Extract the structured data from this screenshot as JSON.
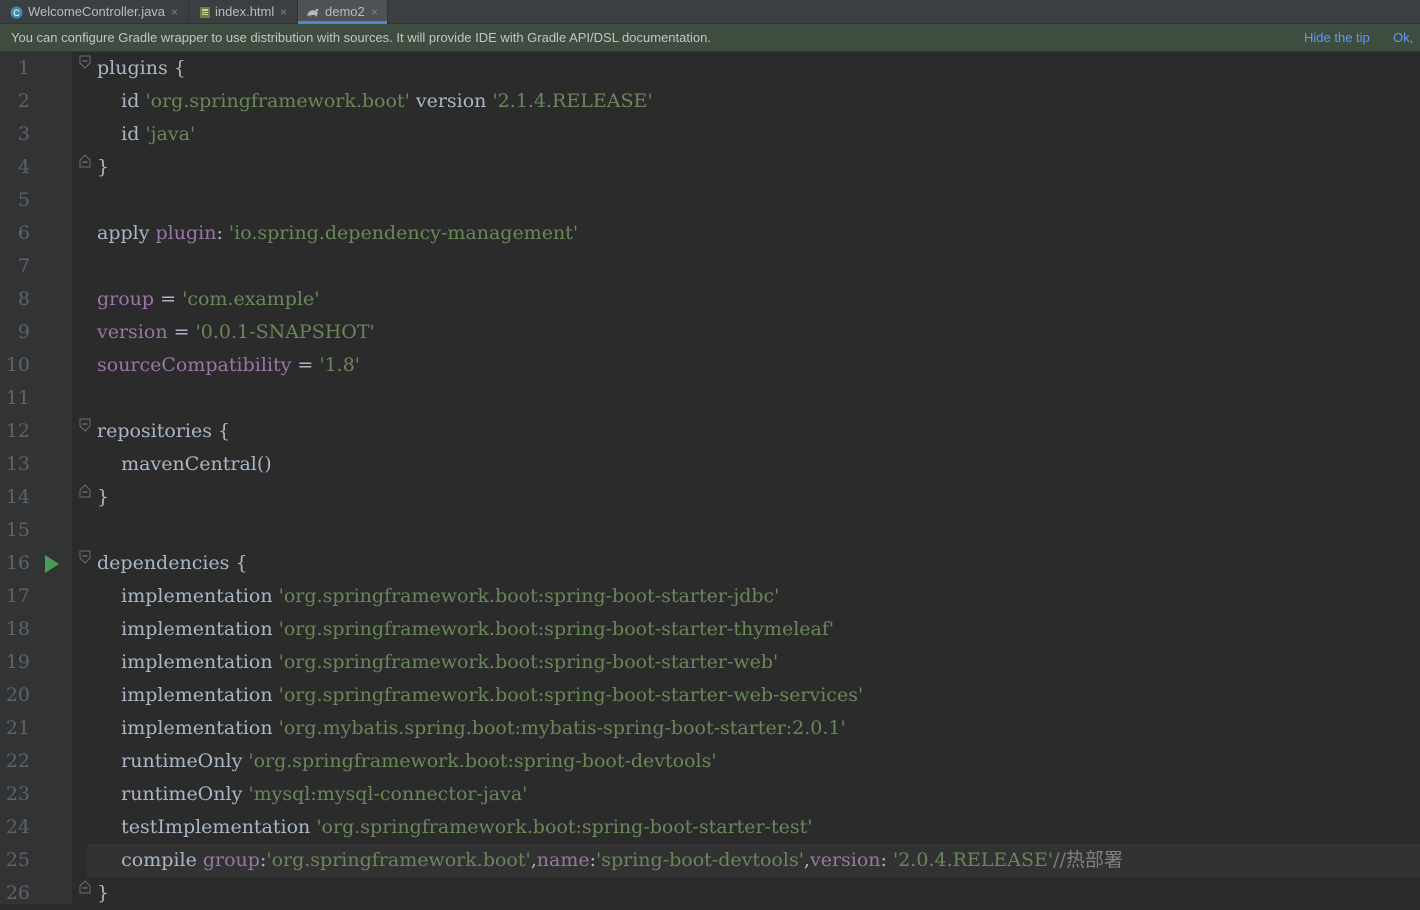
{
  "tabs": [
    {
      "label": "WelcomeController.java",
      "icon": "class-icon",
      "active": false
    },
    {
      "label": "index.html",
      "icon": "html-file-icon",
      "active": false
    },
    {
      "label": "demo2",
      "icon": "gradle-icon",
      "active": true
    }
  ],
  "tab_close_glyph": "×",
  "notification": {
    "message": "You can configure Gradle wrapper to use distribution with sources. It will provide IDE with Gradle API/DSL documentation.",
    "hide_label": "Hide the tip",
    "ok_label": "Ok,"
  },
  "colors": {
    "string": "#6a8759",
    "property": "#9876aa",
    "default_text": "#a9b7c6",
    "background": "#2b2b2b",
    "link": "#589df6"
  },
  "lines": [
    {
      "num": "1",
      "text": "plugins {"
    },
    {
      "num": "2",
      "text": "    id 'org.springframework.boot' version '2.1.4.RELEASE'"
    },
    {
      "num": "3",
      "text": "    id 'java'"
    },
    {
      "num": "4",
      "text": "}"
    },
    {
      "num": "5",
      "text": ""
    },
    {
      "num": "6",
      "text": "apply plugin: 'io.spring.dependency-management'"
    },
    {
      "num": "7",
      "text": ""
    },
    {
      "num": "8",
      "text": "group = 'com.example'"
    },
    {
      "num": "9",
      "text": "version = '0.0.1-SNAPSHOT'"
    },
    {
      "num": "10",
      "text": "sourceCompatibility = '1.8'"
    },
    {
      "num": "11",
      "text": ""
    },
    {
      "num": "12",
      "text": "repositories {"
    },
    {
      "num": "13",
      "text": "    mavenCentral()"
    },
    {
      "num": "14",
      "text": "}"
    },
    {
      "num": "15",
      "text": ""
    },
    {
      "num": "16",
      "text": "dependencies {"
    },
    {
      "num": "17",
      "text": "    implementation 'org.springframework.boot:spring-boot-starter-jdbc'"
    },
    {
      "num": "18",
      "text": "    implementation 'org.springframework.boot:spring-boot-starter-thymeleaf'"
    },
    {
      "num": "19",
      "text": "    implementation 'org.springframework.boot:spring-boot-starter-web'"
    },
    {
      "num": "20",
      "text": "    implementation 'org.springframework.boot:spring-boot-starter-web-services'"
    },
    {
      "num": "21",
      "text": "    implementation 'org.mybatis.spring.boot:mybatis-spring-boot-starter:2.0.1'"
    },
    {
      "num": "22",
      "text": "    runtimeOnly 'org.springframework.boot:spring-boot-devtools'"
    },
    {
      "num": "23",
      "text": "    runtimeOnly 'mysql:mysql-connector-java'"
    },
    {
      "num": "24",
      "text": "    testImplementation 'org.springframework.boot:spring-boot-starter-test'"
    },
    {
      "num": "25",
      "text": "    compile group:'org.springframework.boot',name:'spring-boot-devtools',version: '2.0.4.RELEASE'//热部署"
    },
    {
      "num": "26",
      "text": "}"
    }
  ],
  "current_line": "25",
  "fold_open_lines": [
    "1",
    "12",
    "16"
  ],
  "fold_close_lines": [
    "4",
    "14",
    "26"
  ],
  "run_gutter_line": "16"
}
